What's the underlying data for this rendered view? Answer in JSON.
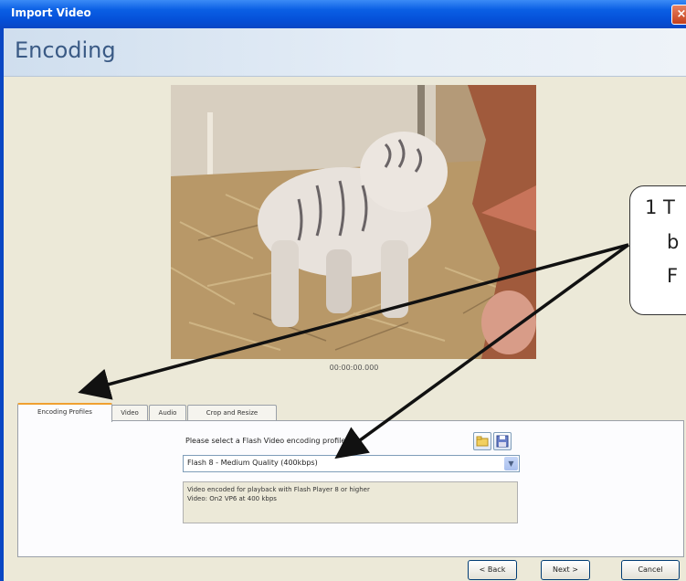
{
  "window": {
    "title": "Import Video",
    "close_glyph": "×"
  },
  "header": {
    "page_title": "Encoding"
  },
  "preview": {
    "timecode": "00:00:00.000"
  },
  "tabs": [
    "Encoding Profiles",
    "Video",
    "Audio",
    "Crop and Resize"
  ],
  "profile": {
    "prompt": "Please select a Flash Video encoding profile:",
    "selected": "Flash 8 - Medium Quality (400kbps)",
    "description_line1": "Video encoded for playback with Flash Player 8 or higher",
    "description_line2": "Video: On2 VP6 at 400 kbps"
  },
  "buttons": {
    "back": "< Back",
    "next": "Next >",
    "cancel": "Cancel"
  },
  "callout": {
    "line1": "1 T",
    "line2": "b",
    "line3": "F"
  },
  "colors": {
    "titlebar": "#0a5fe4",
    "accent_tab": "#f0a030",
    "header_text": "#3a5a85"
  },
  "icons": {
    "close": "close-icon",
    "folder": "folder-icon",
    "save": "save-icon",
    "dropdown": "chevron-down-icon"
  }
}
